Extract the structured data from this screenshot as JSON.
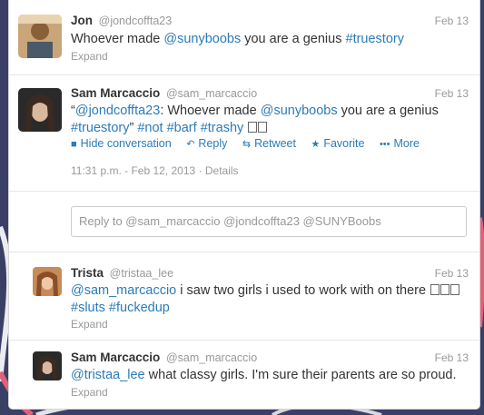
{
  "tweets": [
    {
      "name": "Jon",
      "handle": "@jondcoffta23",
      "date": "Feb 13",
      "text_parts": [
        "Whoever made ",
        "@sunyboobs",
        " you are a genius ",
        "#truestory"
      ],
      "expand": "Expand"
    },
    {
      "name": "Sam Marcaccio",
      "handle": "@sam_marcaccio",
      "date": "Feb 13",
      "line1_parts": [
        "“",
        "@jondcoffta23",
        ": Whoever made ",
        "@sunyboobs",
        " you are a genius"
      ],
      "line2_parts": [
        "#truestory",
        "” ",
        "#not",
        " ",
        "#barf",
        " ",
        "#trashy"
      ],
      "actions": {
        "hide": "Hide conversation",
        "reply": "Reply",
        "retweet": "Retweet",
        "favorite": "Favorite",
        "more": "More"
      },
      "timestamp": "11:31 p.m. - Feb 12, 2013",
      "details": "Details",
      "reply_placeholder": "Reply to @sam_marcaccio @jondcoffta23 @SUNYBoobs"
    },
    {
      "name": "Trista",
      "handle": "@tristaa_lee",
      "date": "Feb 13",
      "line1_parts": [
        "@sam_marcaccio",
        " i saw two girls i used to work with on there"
      ],
      "line2_parts": [
        "#sluts",
        " ",
        "#fuckedup"
      ],
      "expand": "Expand"
    },
    {
      "name": "Sam Marcaccio",
      "handle": "@sam_marcaccio",
      "date": "Feb 13",
      "text_parts": [
        "@tristaa_lee",
        " what classy girls. I'm sure their parents are so proud."
      ],
      "expand": "Expand"
    }
  ],
  "colors": {
    "link": "#2b7bb9",
    "muted": "#999999",
    "background": "#3a3f66"
  },
  "icons": {
    "hide": "speech-bubble-icon",
    "reply": "reply-arrow-icon",
    "retweet": "retweet-icon",
    "favorite": "star-icon",
    "more": "more-dots-icon"
  }
}
